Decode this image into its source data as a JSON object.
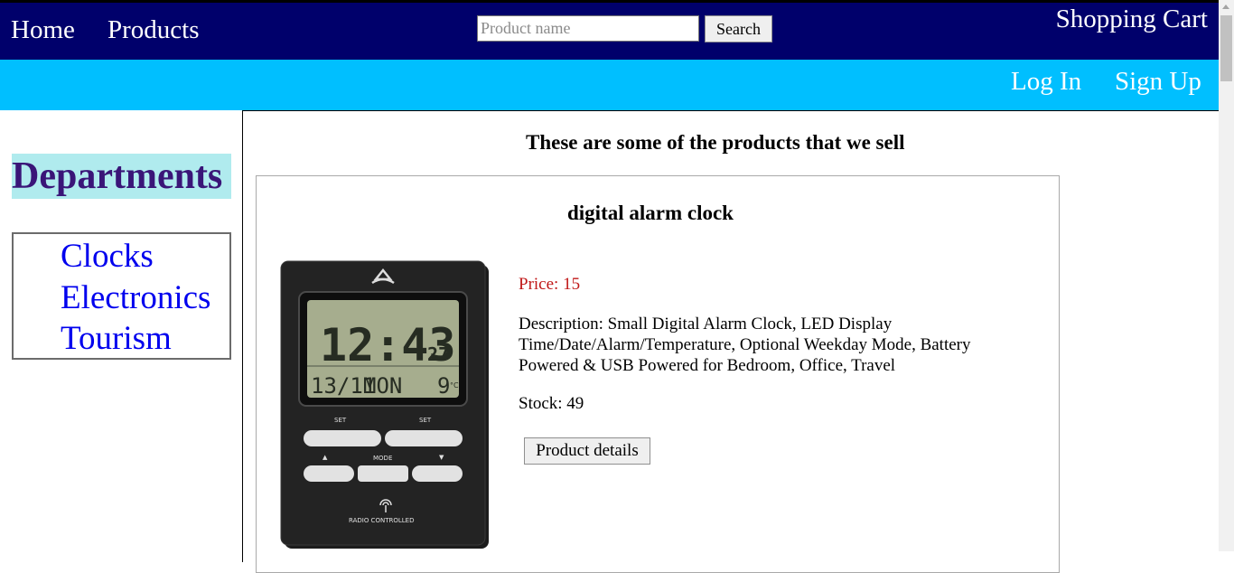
{
  "header": {
    "home_label": "Home",
    "products_label": "Products",
    "search_placeholder": "Product name",
    "search_value": "",
    "search_button_label": "Search",
    "cart_label": "Shopping Cart",
    "login_label": "Log In",
    "signup_label": "Sign Up"
  },
  "colors": {
    "topbar": "#00006b",
    "subbar": "#00bfff",
    "departments_bg": "#b0ebee",
    "departments_text": "#3a1578",
    "link": "#0000ee",
    "price": "#c01818"
  },
  "sidebar": {
    "title": "Departments",
    "items": [
      {
        "label": "Clocks"
      },
      {
        "label": "Electronics"
      },
      {
        "label": "Tourism"
      }
    ]
  },
  "main": {
    "heading": "These are some of the products that we sell",
    "product": {
      "title": "digital alarm clock",
      "price_label": "Price: 15",
      "description": "Description: Small Digital Alarm Clock, LED Display Time/Date/Alarm/Temperature, Optional Weekday Mode, Battery Powered & USB Powered for Bedroom, Office, Travel",
      "stock_label": "Stock: 49",
      "details_button_label": "Product details",
      "image": {
        "alt": "digital alarm clock",
        "time_display": "12:43",
        "seconds_display": "27",
        "date_display": "13/11",
        "weekday_display": "MON",
        "temp_display": "9",
        "temp_unit": "°C",
        "set_label_left": "SET",
        "set_label_right": "SET",
        "mode_label": "MODE",
        "radio_label": "RADIO CONTROLLED",
        "up_arrow": "▲",
        "down_arrow": "▼"
      }
    }
  }
}
